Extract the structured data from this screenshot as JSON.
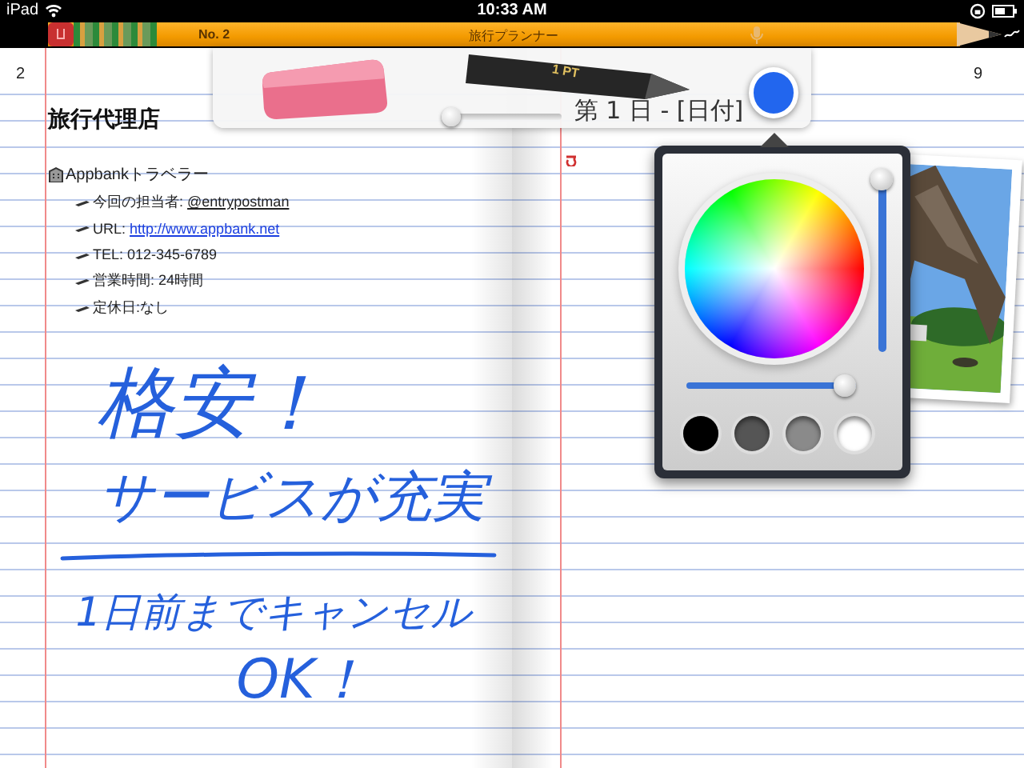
{
  "status_bar": {
    "carrier": "iPad",
    "time": "10:33 AM"
  },
  "pencil_bar": {
    "brand": "No. 2",
    "title": "旅行プランナー"
  },
  "toolbar": {
    "pen_size": "1 PT",
    "size_slider": {
      "level": 0.05
    },
    "color": "#2266ee"
  },
  "left_page": {
    "page_number": "2",
    "heading": "旅行代理店",
    "company": "Appbankトラベラー",
    "items": [
      {
        "kind": "mention",
        "label": "今回の担当者:",
        "value": "@entrypostman"
      },
      {
        "kind": "link",
        "label": "URL:",
        "value": "http://www.appbank.net"
      },
      {
        "kind": "text",
        "label": "TEL: 012-345-6789"
      },
      {
        "kind": "text",
        "label": "営業時間: 24時間"
      },
      {
        "kind": "text",
        "label": "定休日:なし"
      }
    ],
    "handwriting": [
      {
        "kind": "line",
        "text": "格安！"
      },
      {
        "kind": "line",
        "text": "サービスが充実"
      },
      {
        "kind": "rule"
      },
      {
        "kind": "line",
        "text": "1日前までキャンセル"
      },
      {
        "kind": "line",
        "text": "OK！"
      }
    ]
  },
  "right_page": {
    "page_number": "9",
    "date_title": "第 1 日 - [日付]"
  },
  "color_picker": {
    "brightness": {
      "level": 1.0
    },
    "saturation": {
      "level": 0.93
    },
    "swatches": [
      {
        "color": "#000000"
      },
      {
        "color": "#555555"
      },
      {
        "color": "#8a8a8a"
      },
      {
        "color": "#ffffff"
      }
    ]
  }
}
